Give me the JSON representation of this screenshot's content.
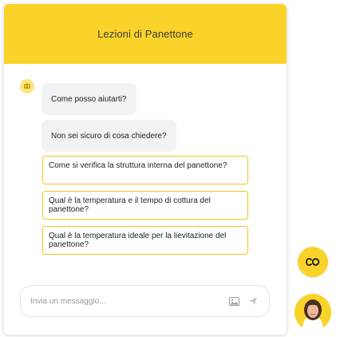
{
  "header": {
    "title": "Lezioni di Panettone"
  },
  "bot": {
    "avatar_icon": "chat-bot-icon",
    "messages": [
      "Come posso aiutarti?",
      "Non sei sicuro di cosa chiedere?"
    ]
  },
  "suggestions": [
    "Come si verifica la struttura interna del panettone?",
    "Qual è la temperatura e il tempo di cottura del panettone?",
    "Qual è la temperatura ideale per la lievitazione del panettone?"
  ],
  "input": {
    "placeholder": "Invia un messaggio...",
    "image_icon": "image-icon",
    "send_icon": "send-icon"
  },
  "launcher": {
    "icon": "link-icon"
  },
  "agent": {
    "avatar": "agent-avatar"
  },
  "colors": {
    "accent": "#f9d32a",
    "suggestion_border": "#f2c41f",
    "bubble_bg": "#f1f2f4"
  }
}
